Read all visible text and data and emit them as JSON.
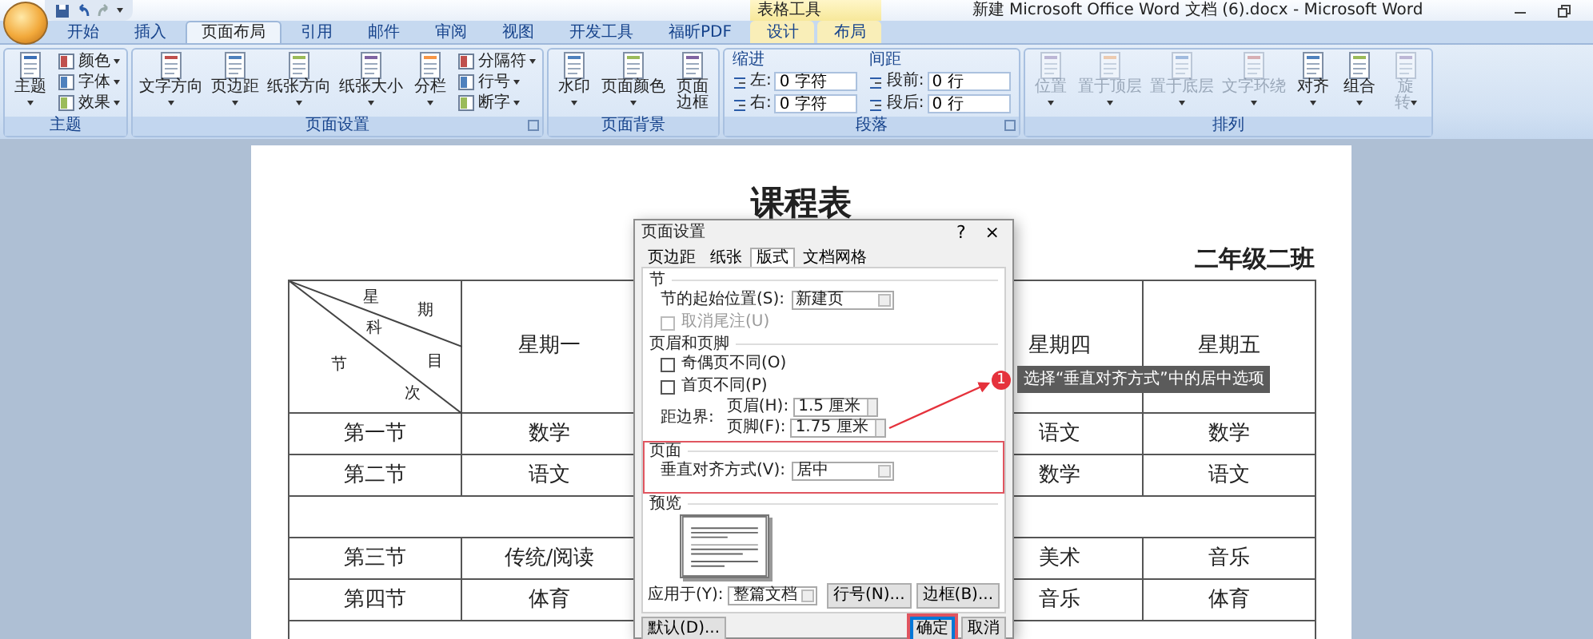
{
  "window": {
    "title": "新建 Microsoft Office Word 文档 (6).docx - Microsoft Word",
    "context_group": "表格工具"
  },
  "tabs": [
    {
      "label": "开始",
      "selected": false,
      "contextual": false
    },
    {
      "label": "插入",
      "selected": false,
      "contextual": false
    },
    {
      "label": "页面布局",
      "selected": true,
      "contextual": false
    },
    {
      "label": "引用",
      "selected": false,
      "contextual": false
    },
    {
      "label": "邮件",
      "selected": false,
      "contextual": false
    },
    {
      "label": "审阅",
      "selected": false,
      "contextual": false
    },
    {
      "label": "视图",
      "selected": false,
      "contextual": false
    },
    {
      "label": "开发工具",
      "selected": false,
      "contextual": false
    },
    {
      "label": "福昕PDF",
      "selected": false,
      "contextual": false
    },
    {
      "label": "设计",
      "selected": false,
      "contextual": true
    },
    {
      "label": "布局",
      "selected": false,
      "contextual": true
    }
  ],
  "ribbon": {
    "groups": [
      {
        "label": "主题",
        "launcher": false,
        "items": [
          {
            "kind": "big",
            "label": "主题",
            "dropdown": true,
            "disabled": false
          },
          {
            "kind": "stack",
            "buttons": [
              {
                "label": "颜色",
                "dropdown": true
              },
              {
                "label": "字体",
                "dropdown": true
              },
              {
                "label": "效果",
                "dropdown": true
              }
            ]
          }
        ]
      },
      {
        "label": "页面设置",
        "launcher": true,
        "items": [
          {
            "kind": "big",
            "label": "文字方向",
            "dropdown": true,
            "disabled": false
          },
          {
            "kind": "big",
            "label": "页边距",
            "dropdown": true,
            "disabled": false
          },
          {
            "kind": "big",
            "label": "纸张方向",
            "dropdown": true,
            "disabled": false
          },
          {
            "kind": "big",
            "label": "纸张大小",
            "dropdown": true,
            "disabled": false
          },
          {
            "kind": "big",
            "label": "分栏",
            "dropdown": true,
            "disabled": false
          },
          {
            "kind": "stack",
            "buttons": [
              {
                "label": "分隔符",
                "dropdown": true
              },
              {
                "label": "行号",
                "dropdown": true
              },
              {
                "label": "断字",
                "dropdown": true
              }
            ]
          }
        ]
      },
      {
        "label": "页面背景",
        "launcher": false,
        "items": [
          {
            "kind": "big",
            "label": "水印",
            "dropdown": true,
            "disabled": false
          },
          {
            "kind": "big",
            "label": "页面颜色",
            "dropdown": true,
            "disabled": false
          },
          {
            "kind": "big",
            "lines": [
              "页面",
              "边框"
            ],
            "dropdown": false,
            "disabled": false
          }
        ]
      },
      {
        "label": "段落",
        "launcher": true,
        "items": [
          {
            "kind": "fields",
            "title": "缩进",
            "fields": [
              {
                "label": "左:",
                "value": "0 字符"
              },
              {
                "label": "右:",
                "value": "0 字符"
              }
            ]
          },
          {
            "kind": "fields",
            "title": "间距",
            "fields": [
              {
                "label": "段前:",
                "value": "0 行"
              },
              {
                "label": "段后:",
                "value": "0 行"
              }
            ]
          }
        ]
      },
      {
        "label": "排列",
        "launcher": false,
        "items": [
          {
            "kind": "big",
            "label": "位置",
            "dropdown": true,
            "disabled": true
          },
          {
            "kind": "big",
            "label": "置于顶层",
            "dropdown": true,
            "disabled": true
          },
          {
            "kind": "big",
            "label": "置于底层",
            "dropdown": true,
            "disabled": true
          },
          {
            "kind": "big",
            "label": "文字环绕",
            "dropdown": true,
            "disabled": true
          },
          {
            "kind": "big",
            "label": "对齐",
            "dropdown": true,
            "disabled": false
          },
          {
            "kind": "big",
            "label": "组合",
            "dropdown": true,
            "disabled": false
          },
          {
            "kind": "big",
            "lines": [
              "旋",
              "转"
            ],
            "dropdown": true,
            "disabled": true
          }
        ]
      }
    ]
  },
  "document": {
    "title": "课程表",
    "subtitle": "二年级二班",
    "table": {
      "corner_labels": [
        "星",
        "期",
        "科",
        "目",
        "节",
        "次"
      ],
      "day_headers": [
        "星期一",
        "星期四",
        "星期五"
      ],
      "rows": [
        {
          "kind": "lesson",
          "period": "第一节",
          "cells": [
            "数学",
            "语文",
            "数学"
          ]
        },
        {
          "kind": "lesson",
          "period": "第二节",
          "cells": [
            "语文",
            "数学",
            "语文"
          ]
        },
        {
          "kind": "break"
        },
        {
          "kind": "lesson",
          "period": "第三节",
          "cells": [
            "传统/阅读",
            "美术",
            "音乐"
          ]
        },
        {
          "kind": "lesson",
          "period": "第四节",
          "cells": [
            "体育",
            "音乐",
            "体育"
          ]
        },
        {
          "kind": "break"
        }
      ]
    }
  },
  "dialog": {
    "title": "页面设置",
    "help": "?",
    "close": "×",
    "tabs": [
      {
        "label": "页边距",
        "selected": false
      },
      {
        "label": "纸张",
        "selected": false
      },
      {
        "label": "版式",
        "selected": true
      },
      {
        "label": "文档网格",
        "selected": false
      }
    ],
    "sections": [
      {
        "title": "节",
        "highlighted": false,
        "rows": [
          {
            "kind": "select",
            "label": "节的起始位置(S):",
            "value": "新建页"
          },
          {
            "kind": "checkbox",
            "label": "取消尾注(U)",
            "checked": false,
            "disabled": true
          }
        ]
      },
      {
        "title": "页眉和页脚",
        "highlighted": false,
        "rows": [
          {
            "kind": "checkbox",
            "label": "奇偶页不同(O)",
            "checked": false,
            "disabled": false
          },
          {
            "kind": "checkbox",
            "label": "首页不同(P)",
            "checked": false,
            "disabled": false
          },
          {
            "kind": "margins",
            "label": "距边界:",
            "spinners": [
              {
                "label": "页眉(H):",
                "value": "1.5 厘米"
              },
              {
                "label": "页脚(F):",
                "value": "1.75 厘米"
              }
            ]
          }
        ]
      },
      {
        "title": "页面",
        "highlighted": true,
        "rows": [
          {
            "kind": "select",
            "label": "垂直对齐方式(V):",
            "value": "居中"
          }
        ]
      },
      {
        "title": "预览",
        "highlighted": false,
        "rows": [
          {
            "kind": "preview"
          }
        ]
      }
    ],
    "apply": {
      "label": "应用于(Y):",
      "value": "整篇文档"
    },
    "side_buttons": [
      "行号(N)...",
      "边框(B)..."
    ],
    "footer_buttons": [
      {
        "label": "默认(D)...",
        "default": false,
        "highlighted": false
      },
      {
        "label": "确定",
        "default": true,
        "highlighted": true
      },
      {
        "label": "取消",
        "default": false,
        "highlighted": false
      }
    ]
  },
  "callout": {
    "number": "1",
    "text": "选择“垂直对齐方式”中的居中选项"
  }
}
